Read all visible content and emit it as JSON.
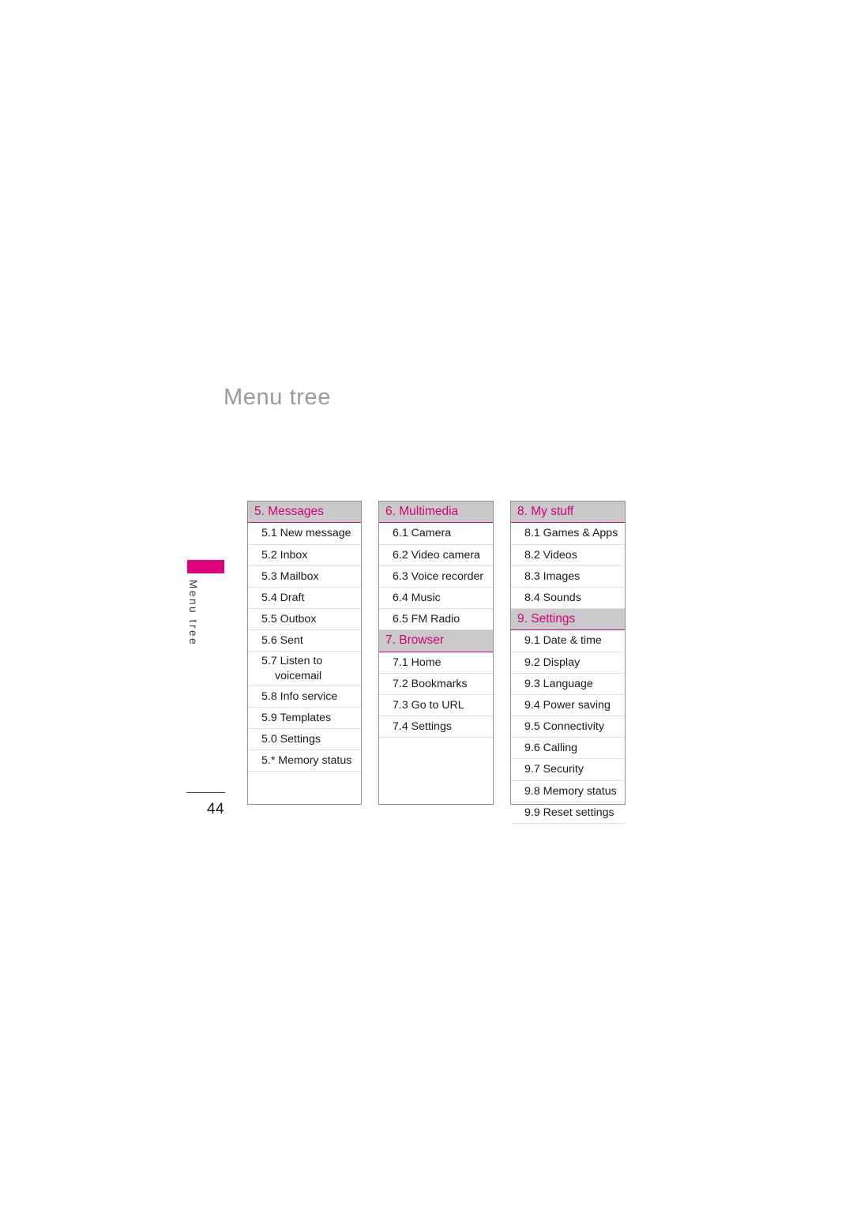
{
  "page": {
    "title": "Menu tree",
    "number": "44",
    "margin_label": "Menu tree"
  },
  "colors": {
    "accent": "#e0007c",
    "header_text": "#d6007a",
    "header_background": "#c9c9c9",
    "title_text": "#9a9a9a",
    "box_border": "#8e8e8e",
    "row_divider": "#dedede"
  },
  "columns": [
    {
      "groups": [
        {
          "header": "5. Messages",
          "items": [
            {
              "text": "5.1 New message"
            },
            {
              "text": "5.2 Inbox"
            },
            {
              "text": "5.3 Mailbox"
            },
            {
              "text": "5.4 Draft"
            },
            {
              "text": "5.5 Outbox"
            },
            {
              "text": "5.6 Sent"
            },
            {
              "text": "5.7 Listen to",
              "text2": "voicemail"
            },
            {
              "text": "5.8 Info service"
            },
            {
              "text": "5.9 Templates"
            },
            {
              "text": "5.0 Settings"
            },
            {
              "text": "5.* Memory status"
            }
          ]
        }
      ]
    },
    {
      "groups": [
        {
          "header": "6. Multimedia",
          "items": [
            {
              "text": "6.1 Camera"
            },
            {
              "text": "6.2 Video camera"
            },
            {
              "text": "6.3 Voice recorder"
            },
            {
              "text": "6.4 Music"
            },
            {
              "text": "6.5 FM Radio"
            }
          ]
        },
        {
          "header": "7. Browser",
          "items": [
            {
              "text": "7.1 Home"
            },
            {
              "text": "7.2 Bookmarks"
            },
            {
              "text": "7.3 Go to URL"
            },
            {
              "text": "7.4 Settings"
            }
          ]
        }
      ]
    },
    {
      "groups": [
        {
          "header": "8. My stuff",
          "items": [
            {
              "text": "8.1 Games & Apps"
            },
            {
              "text": "8.2 Videos"
            },
            {
              "text": "8.3 Images"
            },
            {
              "text": "8.4 Sounds"
            }
          ]
        },
        {
          "header": "9. Settings",
          "items": [
            {
              "text": "9.1 Date & time"
            },
            {
              "text": "9.2 Display"
            },
            {
              "text": "9.3 Language"
            },
            {
              "text": "9.4 Power saving"
            },
            {
              "text": "9.5 Connectivity"
            },
            {
              "text": "9.6 Calling"
            },
            {
              "text": "9.7 Security"
            },
            {
              "text": "9.8 Memory status"
            },
            {
              "text": "9.9 Reset settings"
            }
          ]
        }
      ]
    }
  ]
}
